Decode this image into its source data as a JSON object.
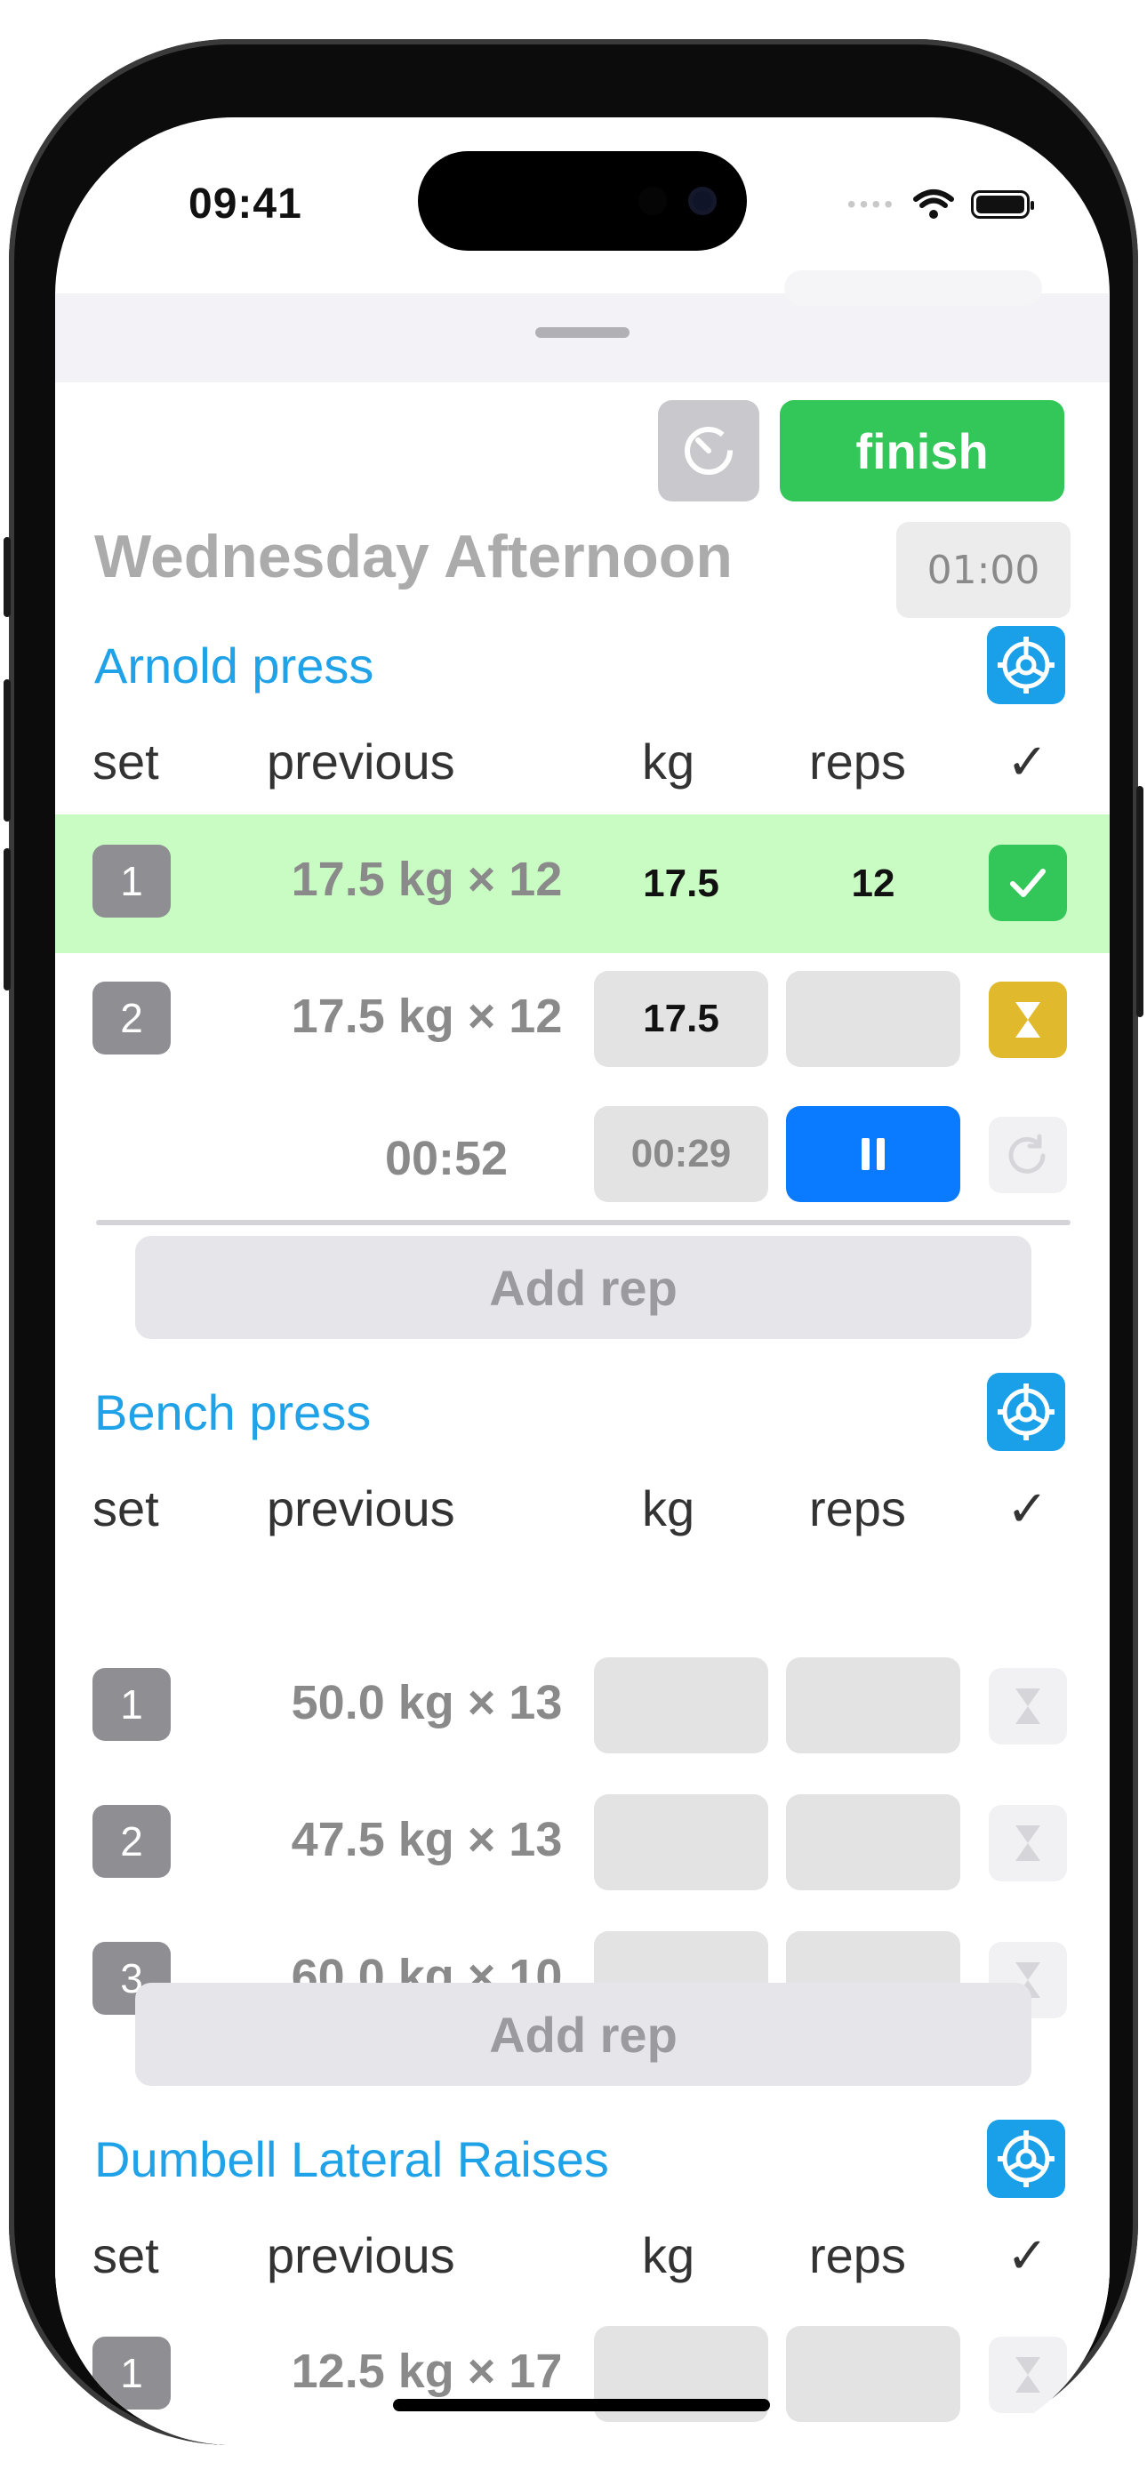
{
  "status_bar": {
    "time": "09:41"
  },
  "toolbar": {
    "finish_label": "finish"
  },
  "workout": {
    "title": "Wednesday Afternoon",
    "clock": "01:00"
  },
  "columns": {
    "set": "set",
    "previous": "previous",
    "kg": "kg",
    "reps": "reps",
    "check": "✓"
  },
  "exercises": [
    {
      "name": "Arnold press",
      "sets": [
        {
          "num": "1",
          "previous": "17.5 kg × 12",
          "kg": "17.5",
          "reps": "12",
          "state": "done"
        },
        {
          "num": "2",
          "previous": "17.5 kg × 12",
          "kg": "17.5",
          "reps": "",
          "state": "resting"
        }
      ],
      "rest_timer": {
        "elapsed": "00:52",
        "remaining": "00:29"
      },
      "add_rep_label": "Add rep"
    },
    {
      "name": "Bench press",
      "sets": [
        {
          "num": "1",
          "previous": "50.0 kg × 13",
          "kg": "",
          "reps": "",
          "state": "pending"
        },
        {
          "num": "2",
          "previous": "47.5 kg × 13",
          "kg": "",
          "reps": "",
          "state": "pending"
        },
        {
          "num": "3",
          "previous": "60.0 kg × 10",
          "kg": "",
          "reps": "",
          "state": "pending"
        }
      ],
      "add_rep_label": "Add rep"
    },
    {
      "name": "Dumbell Lateral Raises",
      "sets": [
        {
          "num": "1",
          "previous": "12.5 kg × 17",
          "kg": "",
          "reps": "",
          "state": "pending"
        }
      ]
    }
  ],
  "colors": {
    "accent": "#1fa2e8",
    "finish": "#33c759",
    "done_row": "#c8fcc3",
    "rest": "#e0b92c",
    "pause": "#0a7aff"
  }
}
